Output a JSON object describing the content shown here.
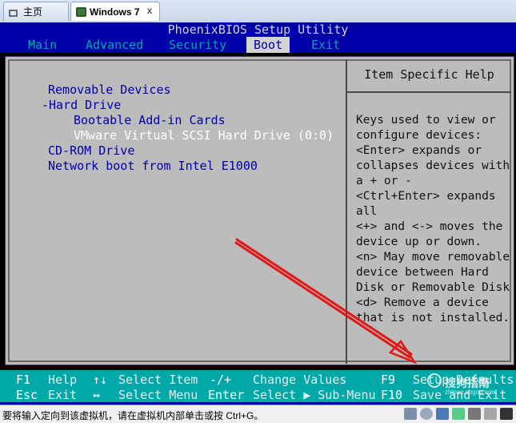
{
  "tabs": [
    {
      "label": "主页",
      "icon": "home-icon"
    },
    {
      "label": "Windows 7",
      "icon": "vm-icon",
      "close": "x"
    }
  ],
  "bios": {
    "title": "PhoenixBIOS Setup Utility",
    "menu": [
      {
        "label": "Main"
      },
      {
        "label": "Advanced"
      },
      {
        "label": "Security"
      },
      {
        "label": "Boot",
        "active": true
      },
      {
        "label": "Exit"
      }
    ],
    "boot_items": [
      "Removable Devices",
      "-Hard Drive",
      "Bootable Add-in Cards",
      "VMware Virtual SCSI Hard Drive (0:0)",
      "CD-ROM Drive",
      "Network boot from Intel E1000"
    ],
    "help_title": "Item Specific Help",
    "help_lines": [
      "Keys used to view or",
      "configure devices:",
      "<Enter> expands or",
      "collapses devices with",
      "a + or -",
      "<Ctrl+Enter> expands",
      "all",
      "<+> and <-> moves the",
      "device up or down.",
      "<n> May move removable",
      "device between Hard",
      "Disk or Removable Disk",
      "<d> Remove a device",
      "that is not installed."
    ],
    "footer_row1": [
      {
        "key": "F1",
        "label": "Help"
      },
      {
        "key": "↑↓",
        "label": "Select Item"
      },
      {
        "key": "-/+",
        "label": "Change Values"
      },
      {
        "key": "F9",
        "label": "Setup Defaults"
      }
    ],
    "footer_row2": [
      {
        "key": "Esc",
        "label": "Exit"
      },
      {
        "key": "↔",
        "label": "Select Menu"
      },
      {
        "key": "Enter",
        "label": "Select ▶ Sub-Menu"
      },
      {
        "key": "F10",
        "label": "Save and Exit"
      }
    ]
  },
  "statusbar": {
    "text": "要将输入定向到该虚拟机，请在虚拟机内部单击或按 Ctrl+G。"
  },
  "watermark": {
    "text": "搜狗指南",
    "sub": "zhinan.sogou.com"
  },
  "colors": {
    "bios_blue": "#0000a8",
    "bios_cyan": "#00a8a8",
    "bios_gray": "#bcbcbc",
    "arrow_red": "#e01818"
  }
}
